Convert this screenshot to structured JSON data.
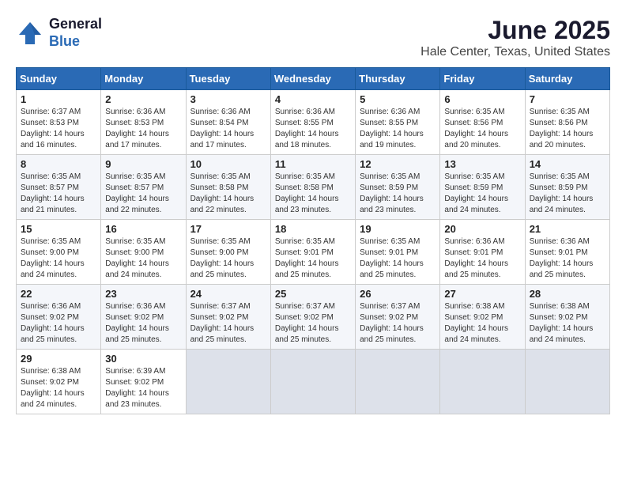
{
  "header": {
    "logo_general": "General",
    "logo_blue": "Blue",
    "month_title": "June 2025",
    "location": "Hale Center, Texas, United States"
  },
  "weekdays": [
    "Sunday",
    "Monday",
    "Tuesday",
    "Wednesday",
    "Thursday",
    "Friday",
    "Saturday"
  ],
  "rows": [
    [
      {
        "day": "1",
        "sunrise": "6:37 AM",
        "sunset": "8:53 PM",
        "daylight": "14 hours and 16 minutes."
      },
      {
        "day": "2",
        "sunrise": "6:36 AM",
        "sunset": "8:53 PM",
        "daylight": "14 hours and 17 minutes."
      },
      {
        "day": "3",
        "sunrise": "6:36 AM",
        "sunset": "8:54 PM",
        "daylight": "14 hours and 17 minutes."
      },
      {
        "day": "4",
        "sunrise": "6:36 AM",
        "sunset": "8:55 PM",
        "daylight": "14 hours and 18 minutes."
      },
      {
        "day": "5",
        "sunrise": "6:36 AM",
        "sunset": "8:55 PM",
        "daylight": "14 hours and 19 minutes."
      },
      {
        "day": "6",
        "sunrise": "6:35 AM",
        "sunset": "8:56 PM",
        "daylight": "14 hours and 20 minutes."
      },
      {
        "day": "7",
        "sunrise": "6:35 AM",
        "sunset": "8:56 PM",
        "daylight": "14 hours and 20 minutes."
      }
    ],
    [
      {
        "day": "8",
        "sunrise": "6:35 AM",
        "sunset": "8:57 PM",
        "daylight": "14 hours and 21 minutes."
      },
      {
        "day": "9",
        "sunrise": "6:35 AM",
        "sunset": "8:57 PM",
        "daylight": "14 hours and 22 minutes."
      },
      {
        "day": "10",
        "sunrise": "6:35 AM",
        "sunset": "8:58 PM",
        "daylight": "14 hours and 22 minutes."
      },
      {
        "day": "11",
        "sunrise": "6:35 AM",
        "sunset": "8:58 PM",
        "daylight": "14 hours and 23 minutes."
      },
      {
        "day": "12",
        "sunrise": "6:35 AM",
        "sunset": "8:59 PM",
        "daylight": "14 hours and 23 minutes."
      },
      {
        "day": "13",
        "sunrise": "6:35 AM",
        "sunset": "8:59 PM",
        "daylight": "14 hours and 24 minutes."
      },
      {
        "day": "14",
        "sunrise": "6:35 AM",
        "sunset": "8:59 PM",
        "daylight": "14 hours and 24 minutes."
      }
    ],
    [
      {
        "day": "15",
        "sunrise": "6:35 AM",
        "sunset": "9:00 PM",
        "daylight": "14 hours and 24 minutes."
      },
      {
        "day": "16",
        "sunrise": "6:35 AM",
        "sunset": "9:00 PM",
        "daylight": "14 hours and 24 minutes."
      },
      {
        "day": "17",
        "sunrise": "6:35 AM",
        "sunset": "9:00 PM",
        "daylight": "14 hours and 25 minutes."
      },
      {
        "day": "18",
        "sunrise": "6:35 AM",
        "sunset": "9:01 PM",
        "daylight": "14 hours and 25 minutes."
      },
      {
        "day": "19",
        "sunrise": "6:35 AM",
        "sunset": "9:01 PM",
        "daylight": "14 hours and 25 minutes."
      },
      {
        "day": "20",
        "sunrise": "6:36 AM",
        "sunset": "9:01 PM",
        "daylight": "14 hours and 25 minutes."
      },
      {
        "day": "21",
        "sunrise": "6:36 AM",
        "sunset": "9:01 PM",
        "daylight": "14 hours and 25 minutes."
      }
    ],
    [
      {
        "day": "22",
        "sunrise": "6:36 AM",
        "sunset": "9:02 PM",
        "daylight": "14 hours and 25 minutes."
      },
      {
        "day": "23",
        "sunrise": "6:36 AM",
        "sunset": "9:02 PM",
        "daylight": "14 hours and 25 minutes."
      },
      {
        "day": "24",
        "sunrise": "6:37 AM",
        "sunset": "9:02 PM",
        "daylight": "14 hours and 25 minutes."
      },
      {
        "day": "25",
        "sunrise": "6:37 AM",
        "sunset": "9:02 PM",
        "daylight": "14 hours and 25 minutes."
      },
      {
        "day": "26",
        "sunrise": "6:37 AM",
        "sunset": "9:02 PM",
        "daylight": "14 hours and 25 minutes."
      },
      {
        "day": "27",
        "sunrise": "6:38 AM",
        "sunset": "9:02 PM",
        "daylight": "14 hours and 24 minutes."
      },
      {
        "day": "28",
        "sunrise": "6:38 AM",
        "sunset": "9:02 PM",
        "daylight": "14 hours and 24 minutes."
      }
    ],
    [
      {
        "day": "29",
        "sunrise": "6:38 AM",
        "sunset": "9:02 PM",
        "daylight": "14 hours and 24 minutes."
      },
      {
        "day": "30",
        "sunrise": "6:39 AM",
        "sunset": "9:02 PM",
        "daylight": "14 hours and 23 minutes."
      },
      null,
      null,
      null,
      null,
      null
    ]
  ],
  "labels": {
    "sunrise": "Sunrise:",
    "sunset": "Sunset:",
    "daylight": "Daylight:"
  }
}
